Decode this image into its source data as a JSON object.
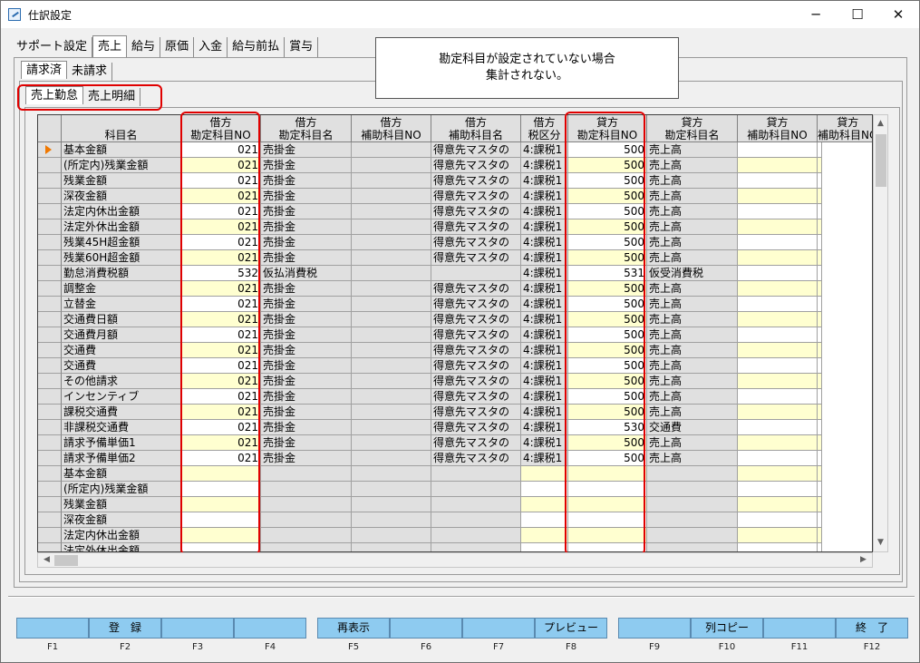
{
  "window": {
    "title": "仕訳設定",
    "minimize": "─",
    "maximize": "☐",
    "close": "✕"
  },
  "tabs_main": [
    "サポート設定",
    "売上",
    "給与",
    "原価",
    "入金",
    "給与前払",
    "賞与"
  ],
  "tabs_main_active": 1,
  "tabs_sub": [
    "請求済",
    "未請求"
  ],
  "tabs_sub3": [
    "売上勤怠",
    "売上明細"
  ],
  "notice": {
    "line1": "勘定科目が設定されていない場合",
    "line2": "集計されない。"
  },
  "grid": {
    "headers": [
      {
        "l1": "",
        "l2": "科目名"
      },
      {
        "l1": "借方",
        "l2": "勘定科目NO"
      },
      {
        "l1": "借方",
        "l2": "勘定科目名"
      },
      {
        "l1": "借方",
        "l2": "補助科目NO"
      },
      {
        "l1": "借方",
        "l2": "補助科目名"
      },
      {
        "l1": "借方",
        "l2": "税区分"
      },
      {
        "l1": "貸方",
        "l2": "勘定科目NO"
      },
      {
        "l1": "貸方",
        "l2": "勘定科目名"
      },
      {
        "l1": "貸方",
        "l2": "補助科目NO"
      },
      {
        "l1": "貸方",
        "l2": "補助科目NO"
      }
    ],
    "rows": [
      [
        "基本金額",
        "021",
        "売掛金",
        "",
        "得意先マスタの",
        "4:課税1",
        "500",
        "売上高"
      ],
      [
        "(所定内)残業金額",
        "021",
        "売掛金",
        "",
        "得意先マスタの",
        "4:課税1",
        "500",
        "売上高"
      ],
      [
        "残業金額",
        "021",
        "売掛金",
        "",
        "得意先マスタの",
        "4:課税1",
        "500",
        "売上高"
      ],
      [
        "深夜金額",
        "021",
        "売掛金",
        "",
        "得意先マスタの",
        "4:課税1",
        "500",
        "売上高"
      ],
      [
        "法定内休出金額",
        "021",
        "売掛金",
        "",
        "得意先マスタの",
        "4:課税1",
        "500",
        "売上高"
      ],
      [
        "法定外休出金額",
        "021",
        "売掛金",
        "",
        "得意先マスタの",
        "4:課税1",
        "500",
        "売上高"
      ],
      [
        "残業45H超金額",
        "021",
        "売掛金",
        "",
        "得意先マスタの",
        "4:課税1",
        "500",
        "売上高"
      ],
      [
        "残業60H超金額",
        "021",
        "売掛金",
        "",
        "得意先マスタの",
        "4:課税1",
        "500",
        "売上高"
      ],
      [
        "勤怠消費税額",
        "532",
        "仮払消費税",
        "",
        "",
        "4:課税1",
        "531",
        "仮受消費税"
      ],
      [
        "調整金",
        "021",
        "売掛金",
        "",
        "得意先マスタの",
        "4:課税1",
        "500",
        "売上高"
      ],
      [
        "立替金",
        "021",
        "売掛金",
        "",
        "得意先マスタの",
        "4:課税1",
        "500",
        "売上高"
      ],
      [
        "交通費日額",
        "021",
        "売掛金",
        "",
        "得意先マスタの",
        "4:課税1",
        "500",
        "売上高"
      ],
      [
        "交通費月額",
        "021",
        "売掛金",
        "",
        "得意先マスタの",
        "4:課税1",
        "500",
        "売上高"
      ],
      [
        "交通費",
        "021",
        "売掛金",
        "",
        "得意先マスタの",
        "4:課税1",
        "500",
        "売上高"
      ],
      [
        "交通費",
        "021",
        "売掛金",
        "",
        "得意先マスタの",
        "4:課税1",
        "500",
        "売上高"
      ],
      [
        "その他請求",
        "021",
        "売掛金",
        "",
        "得意先マスタの",
        "4:課税1",
        "500",
        "売上高"
      ],
      [
        "インセンティブ",
        "021",
        "売掛金",
        "",
        "得意先マスタの",
        "4:課税1",
        "500",
        "売上高"
      ],
      [
        "課税交通費",
        "021",
        "売掛金",
        "",
        "得意先マスタの",
        "4:課税1",
        "500",
        "売上高"
      ],
      [
        "非課税交通費",
        "021",
        "売掛金",
        "",
        "得意先マスタの",
        "4:課税1",
        "530",
        "交通費"
      ],
      [
        "請求予備単価1",
        "021",
        "売掛金",
        "",
        "得意先マスタの",
        "4:課税1",
        "500",
        "売上高"
      ],
      [
        "請求予備単価2",
        "021",
        "売掛金",
        "",
        "得意先マスタの",
        "4:課税1",
        "500",
        "売上高"
      ],
      [
        "基本金額",
        "",
        "",
        "",
        "",
        "",
        "",
        ""
      ],
      [
        "(所定内)残業金額",
        "",
        "",
        "",
        "",
        "",
        "",
        ""
      ],
      [
        "残業金額",
        "",
        "",
        "",
        "",
        "",
        "",
        ""
      ],
      [
        "深夜金額",
        "",
        "",
        "",
        "",
        "",
        "",
        ""
      ],
      [
        "法定内休出金額",
        "",
        "",
        "",
        "",
        "",
        "",
        ""
      ],
      [
        "法定外休出金額",
        "",
        "",
        "",
        "",
        "",
        "",
        ""
      ]
    ]
  },
  "fkeys": [
    {
      "label": "",
      "key": "F1"
    },
    {
      "label": "登　録",
      "key": "F2"
    },
    {
      "label": "",
      "key": "F3"
    },
    {
      "label": "",
      "key": "F4"
    },
    {
      "label": "再表示",
      "key": "F5"
    },
    {
      "label": "",
      "key": "F6"
    },
    {
      "label": "",
      "key": "F7"
    },
    {
      "label": "プレビュー",
      "key": "F8"
    },
    {
      "label": "",
      "key": "F9"
    },
    {
      "label": "列コピー",
      "key": "F10"
    },
    {
      "label": "",
      "key": "F11"
    },
    {
      "label": "終　了",
      "key": "F12"
    }
  ],
  "colors": {
    "highlight_red": "#e00000",
    "row_yellow": "#ffffd0",
    "fkey_blue": "#8ecbf0",
    "row_pointer": "#f07800"
  }
}
